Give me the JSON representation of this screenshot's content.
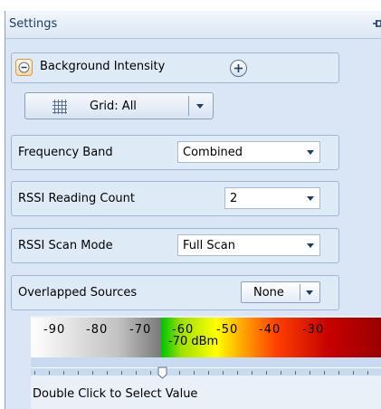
{
  "panel": {
    "title": "Settings"
  },
  "background_intensity": {
    "label": "Background Intensity"
  },
  "grid_button": {
    "label": "Grid: All"
  },
  "frequency_band": {
    "label": "Frequency Band",
    "value": "Combined"
  },
  "rssi_reading_count": {
    "label": "RSSI Reading Count",
    "value": "2"
  },
  "rssi_scan_mode": {
    "label": "RSSI Scan Mode",
    "value": "Full Scan"
  },
  "overlapped_sources": {
    "label": "Overlapped Sources",
    "value": "None"
  },
  "rssi_scale": {
    "ticks": [
      "-90",
      "-80",
      "-70",
      "-60",
      "-50",
      "-40",
      "-30"
    ],
    "current_value": "-70 dBm",
    "hint": "Double Click to Select Value"
  },
  "colors": {
    "panel_bg": "#dae6f6",
    "accent_orange": "#e69632",
    "border": "#9fb7d6"
  }
}
